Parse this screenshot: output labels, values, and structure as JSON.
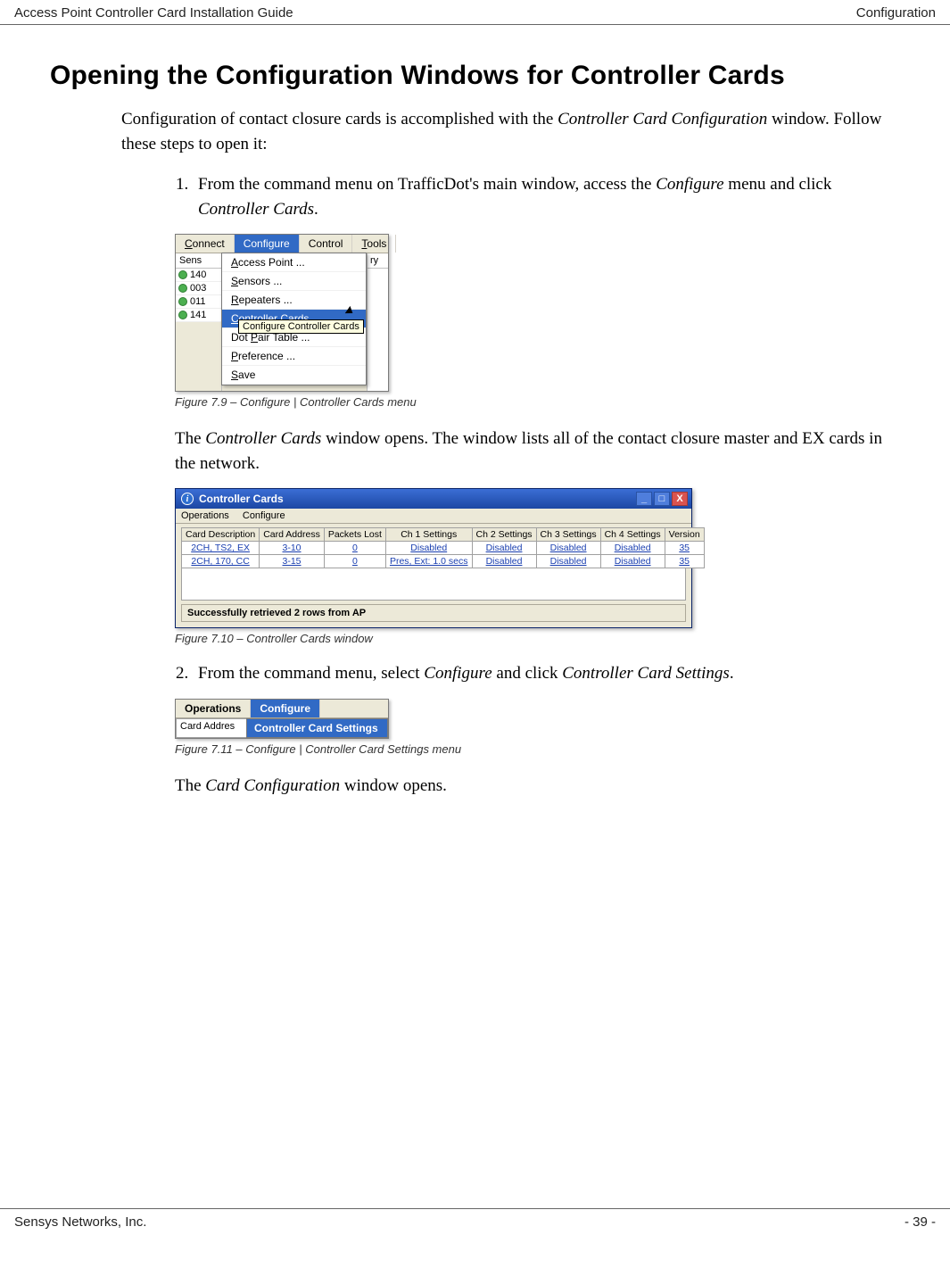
{
  "header": {
    "left": "Access Point Controller Card Installation Guide",
    "right": "Configuration"
  },
  "footer": {
    "left": "Sensys Networks, Inc.",
    "right": "- 39 -"
  },
  "section_title": "Opening the Configuration Windows for Controller Cards",
  "intro_a": "Configuration of contact closure cards is accomplished with the ",
  "intro_em": "Controller Card Configuration",
  "intro_b": " window. Follow these steps to open it:",
  "step1_a": "From the command menu on TrafficDot's main window, access the ",
  "step1_em1": "Configure",
  "step1_b": " menu and click ",
  "step1_em2": "Controller Cards",
  "step1_c": ".",
  "fig79": {
    "caption": "Figure 7.9 – Configure | Controller Cards menu",
    "menubar": {
      "connect": "Connect",
      "configure": "Configure",
      "control": "Control",
      "tools": "Tools"
    },
    "sens_header": "Sens",
    "sens_rows": [
      "140",
      "003",
      "011",
      "141"
    ],
    "right_header": "ry",
    "dropdown": {
      "access_point": "Access Point ...",
      "sensors": "Sensors ...",
      "repeaters": "Repeaters ...",
      "controller_cards": "Controller Cards ...",
      "tooltip": "Configure Controller Cards",
      "dot_pair": "Dot Pair Table ...",
      "preference": "Preference ...",
      "save": "Save"
    }
  },
  "after_fig79_a": "The ",
  "after_fig79_em": "Controller Cards",
  "after_fig79_b": " window opens. The window lists all of the contact closure master and EX cards in the network.",
  "fig710": {
    "caption": "Figure 7.10 – Controller Cards window",
    "title": "Controller Cards",
    "menubar": {
      "operations": "Operations",
      "configure": "Configure"
    },
    "columns": [
      "Card Description",
      "Card Address",
      "Packets Lost",
      "Ch 1 Settings",
      "Ch 2 Settings",
      "Ch 3 Settings",
      "Ch 4 Settings",
      "Version"
    ],
    "rows": [
      {
        "desc": "2CH, TS2, EX",
        "addr": "3-10",
        "lost": "0",
        "ch1": "Disabled",
        "ch2": "Disabled",
        "ch3": "Disabled",
        "ch4": "Disabled",
        "ver": "35"
      },
      {
        "desc": "2CH, 170, CC",
        "addr": "3-15",
        "lost": "0",
        "ch1": "Pres, Ext: 1.0 secs",
        "ch2": "Disabled",
        "ch3": "Disabled",
        "ch4": "Disabled",
        "ver": "35"
      }
    ],
    "status": "Successfully retrieved 2 rows from AP"
  },
  "step2_a": "From the command menu, select ",
  "step2_em1": "Configure",
  "step2_b": " and click ",
  "step2_em2": "Controller Card Settings",
  "step2_c": ".",
  "fig711": {
    "caption": "Figure 7.11 – Configure | Controller Card Settings menu",
    "menubar": {
      "operations": "Operations",
      "configure": "Configure"
    },
    "left_cell": "Card Addres",
    "item": "Controller Card Settings"
  },
  "after_fig711_a": "The ",
  "after_fig711_em": "Card Configuration",
  "after_fig711_b": " window opens."
}
